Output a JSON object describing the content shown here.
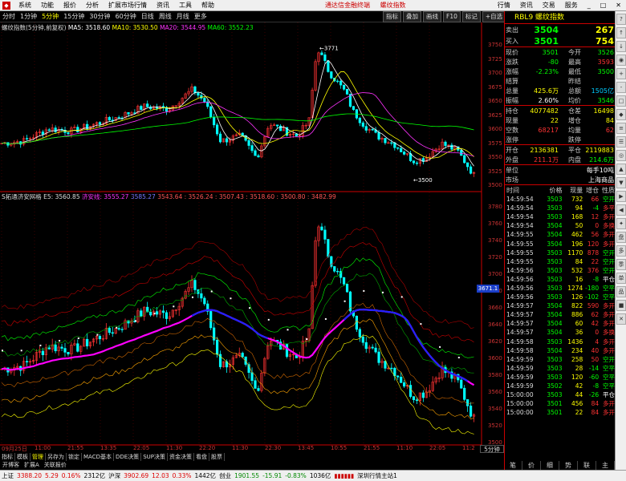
{
  "menu": {
    "items": [
      "系统",
      "功能",
      "报价",
      "分析",
      "扩展市场行情",
      "资讯",
      "工具",
      "帮助"
    ],
    "center": [
      "通达信金融终端",
      "螺纹指数"
    ],
    "right": [
      "行情",
      "资讯",
      "交易",
      "服务"
    ]
  },
  "periods": [
    "分时",
    "1分钟",
    "5分钟",
    "15分钟",
    "30分钟",
    "60分钟",
    "日线",
    "周线",
    "月线",
    "更多"
  ],
  "periods_selected": 2,
  "tools": [
    "指标",
    "叠加",
    "画线",
    "F10",
    "标记",
    "+自选",
    "返回"
  ],
  "main_legend": {
    "name": "螺纹指数(5分钟,前复权)",
    "ma5": "MA5: 3518.60",
    "ma10": "MA10: 3530.50",
    "ma20": "MA20: 3544.95",
    "ma60": "MA60: 3552.23"
  },
  "sub_legend": {
    "name": "S拓通济安网格",
    "e5": "E5: 3560.85",
    "a": "济安线: 3555.27",
    "b": "3585.27",
    "c": "3543.64 : 3526.24 : 3507.43 : 3518.60 : 3500.80 : 3482.99"
  },
  "main_axis": [
    "3750",
    "3725",
    "3700",
    "3675",
    "3650",
    "3625",
    "3600",
    "3575",
    "3550",
    "3525",
    "3500"
  ],
  "sub_axis": [
    "3780",
    "3760",
    "3740",
    "3720",
    "3700",
    "3680",
    "3660",
    "3640",
    "3620",
    "3600",
    "3580",
    "3560",
    "3540",
    "3520",
    "3500"
  ],
  "high_label": "3771",
  "low_label": "3500",
  "cur_price": "3671.1",
  "timeaxis": [
    "09月25日",
    "11:00",
    "21:55",
    "13:35",
    "22:05",
    "11:30",
    "22:20",
    "11:30",
    "22:30",
    "13:45",
    "10:55",
    "21:55",
    "11:10",
    "22:05",
    "11:2"
  ],
  "period5": "5分钟",
  "ind_tabs": [
    "指标",
    "模板",
    "管理",
    "另存为",
    "锁定",
    "MACD基本",
    "DDE决策",
    "SUP决策",
    "资金决策",
    "看盘",
    "股票"
  ],
  "ind_tabs2": [
    "开博客",
    "扩展A",
    "关联报价"
  ],
  "rp": {
    "code": "RBL9",
    "name": "螺纹指数",
    "sell_label": "卖出",
    "sell_price": "3504",
    "sell_vol": "267",
    "buy_label": "买入",
    "buy_price": "3501",
    "buy_vol": "754",
    "rows": [
      {
        "a": "现价",
        "b": "3501",
        "c": "今开",
        "d": "3526",
        "bc": "c-g",
        "dc": "c-g"
      },
      {
        "a": "涨跌",
        "b": "-80",
        "c": "最高",
        "d": "3593",
        "bc": "c-g",
        "dc": "c-r"
      },
      {
        "a": "涨幅",
        "b": "-2.23%",
        "c": "最低",
        "d": "3500",
        "bc": "c-g",
        "dc": "c-g"
      },
      {
        "a": "结算",
        "b": "",
        "c": "昨结",
        "d": "",
        "bc": "c-w",
        "dc": "c-w"
      },
      {
        "a": "总量",
        "b": "425.6万",
        "c": "总额",
        "d": "1505亿",
        "bc": "c-y",
        "dc": "c-c"
      },
      {
        "a": "振幅",
        "b": "2.60%",
        "c": "均价",
        "d": "3546",
        "bc": "c-w",
        "dc": "c-g"
      }
    ],
    "rows2": [
      {
        "a": "持仓",
        "b": "4077482",
        "c": "仓差",
        "d": "16498",
        "bc": "c-y",
        "dc": "c-y"
      },
      {
        "a": "现量",
        "b": "22",
        "c": "增仓",
        "d": "84",
        "bc": "c-y",
        "dc": "c-y"
      },
      {
        "a": "空数",
        "b": "68217",
        "c": "均量",
        "d": "62",
        "bc": "c-r",
        "dc": "c-r"
      },
      {
        "a": "涨停",
        "b": "",
        "c": "跌停",
        "d": "",
        "bc": "c-w",
        "dc": "c-w"
      }
    ],
    "rows3": [
      {
        "a": "开仓",
        "b": "2136381",
        "c": "平仓",
        "d": "2119883",
        "bc": "c-y",
        "dc": "c-y"
      },
      {
        "a": "外盘",
        "b": "211.1万",
        "c": "内盘",
        "d": "214.6万",
        "bc": "c-r",
        "dc": "c-g"
      }
    ],
    "unit_label": "单位",
    "unit_val": "每手10吨",
    "market_label": "市场",
    "market_val": "上海商品",
    "tick_header": [
      "时间",
      "价格",
      "现量",
      "增仓",
      "性质"
    ],
    "ticks": [
      [
        "14:59:54",
        "3503",
        "732",
        "66",
        "空开",
        "c-g"
      ],
      [
        "14:59:54",
        "3503",
        "94",
        "-4",
        "多平",
        "c-r"
      ],
      [
        "14:59:54",
        "3503",
        "168",
        "12",
        "多开",
        "c-r"
      ],
      [
        "14:59:54",
        "3504",
        "50",
        "0",
        "多换",
        "c-r"
      ],
      [
        "14:59:55",
        "3504",
        "462",
        "56",
        "多开",
        "c-r"
      ],
      [
        "14:59:55",
        "3504",
        "196",
        "120",
        "多开",
        "c-r"
      ],
      [
        "14:59:55",
        "3503",
        "1170",
        "878",
        "空开",
        "c-g"
      ],
      [
        "14:59:55",
        "3503",
        "84",
        "22",
        "空开",
        "c-g"
      ],
      [
        "14:59:56",
        "3503",
        "532",
        "376",
        "空开",
        "c-g"
      ],
      [
        "14:59:56",
        "3503",
        "16",
        "-8",
        "平仓",
        "c-w"
      ],
      [
        "14:59:56",
        "3503",
        "1274",
        "-180",
        "空平",
        "c-g"
      ],
      [
        "14:59:56",
        "3503",
        "126",
        "-102",
        "空平",
        "c-g"
      ],
      [
        "14:59:57",
        "3504",
        "822",
        "590",
        "多开",
        "c-r"
      ],
      [
        "14:59:57",
        "3504",
        "886",
        "62",
        "多开",
        "c-r"
      ],
      [
        "14:59:57",
        "3504",
        "60",
        "42",
        "多开",
        "c-r"
      ],
      [
        "14:59:57",
        "3504",
        "36",
        "0",
        "多换",
        "c-r"
      ],
      [
        "14:59:58",
        "3503",
        "1436",
        "4",
        "多开",
        "c-r"
      ],
      [
        "14:59:58",
        "3504",
        "234",
        "40",
        "多开",
        "c-r"
      ],
      [
        "14:59:59",
        "3503",
        "258",
        "50",
        "空开",
        "c-g"
      ],
      [
        "14:59:59",
        "3503",
        "28",
        "-14",
        "空平",
        "c-g"
      ],
      [
        "14:59:59",
        "3503",
        "120",
        "-60",
        "空平",
        "c-g"
      ],
      [
        "14:59:59",
        "3502",
        "42",
        "-8",
        "空平",
        "c-g"
      ],
      [
        "15:00:00",
        "3503",
        "44",
        "-26",
        "平仓",
        "c-w"
      ],
      [
        "15:00:00",
        "3501",
        "456",
        "84",
        "多开",
        "c-r"
      ],
      [
        "15:00:00",
        "3501",
        "22",
        "84",
        "多开",
        "c-r"
      ]
    ],
    "tabs": [
      "笔",
      "价",
      "细",
      "势",
      "联",
      "主"
    ]
  },
  "side_buttons": [
    "?",
    "↑",
    "↓",
    "◉",
    "+",
    "-",
    "□",
    "◆",
    "≡",
    "☰",
    "◎",
    "▲",
    "▼",
    "▶",
    "◀",
    "✦",
    "盘",
    "多",
    "季",
    "单",
    "品",
    "■",
    "✕"
  ],
  "status": [
    {
      "t": "上证",
      "c": ""
    },
    {
      "t": "3388.20",
      "c": "red"
    },
    {
      "t": "5.29",
      "c": "red"
    },
    {
      "t": "0.16%",
      "c": "red"
    },
    {
      "t": "2312亿",
      "c": ""
    },
    {
      "t": "沪深",
      "c": ""
    },
    {
      "t": "3902.69",
      "c": "red"
    },
    {
      "t": "12.03",
      "c": "red"
    },
    {
      "t": "0.33%",
      "c": "red"
    },
    {
      "t": "1442亿",
      "c": ""
    },
    {
      "t": "创业",
      "c": ""
    },
    {
      "t": "1901.55",
      "c": "grn"
    },
    {
      "t": "-15.91",
      "c": "grn"
    },
    {
      "t": "-0.83%",
      "c": "grn"
    },
    {
      "t": "1036亿",
      "c": ""
    },
    {
      "t": "深圳行情主站1",
      "c": ""
    }
  ]
}
